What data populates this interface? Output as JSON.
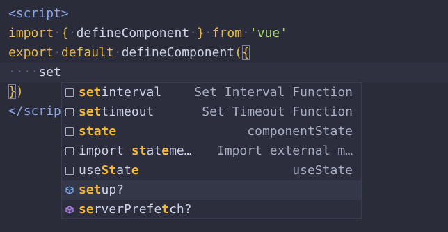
{
  "colors": {
    "background": "#2a2c3a",
    "keyword": "#e6b84e",
    "tag": "#8aa2e6",
    "string": "#a5d46e",
    "match_highlight": "#f1b93a",
    "widget_background": "#2c2e3d"
  },
  "code": {
    "line1": {
      "open": "<",
      "tag": "script",
      "close": ">"
    },
    "line2": {
      "kw": "import",
      "brace_open": "{",
      "name": "defineComponent",
      "brace_close": "}",
      "from": "from",
      "module": "'vue'"
    },
    "line3": {
      "kw_export": "export",
      "kw_default": "default",
      "fn": "defineComponent",
      "paren": "(",
      "brace": "{"
    },
    "line4": {
      "indent": "····",
      "text": "set"
    },
    "line5": {
      "brace": "}",
      "paren": ")"
    },
    "line6": {
      "open": "</",
      "tag": "scrip"
    }
  },
  "suggestions": [
    {
      "icon": "square-icon",
      "match": "set",
      "rest": "interval",
      "detail": "Set Interval Function"
    },
    {
      "icon": "square-icon",
      "match": "set",
      "rest": "timeout",
      "detail": "Set Timeout Function"
    },
    {
      "icon": "square-icon",
      "pre": "",
      "label_html": "state",
      "detail": "componentState"
    },
    {
      "icon": "square-icon",
      "label_html": "import stateme…",
      "detail": "Import external m…"
    },
    {
      "icon": "square-icon",
      "label_html": "useState",
      "detail": "useState"
    },
    {
      "icon": "cube-icon",
      "match": "set",
      "rest": "up?",
      "detail": ""
    },
    {
      "icon": "cube-icon",
      "label_html": "serverPrefetch?",
      "detail": ""
    }
  ]
}
